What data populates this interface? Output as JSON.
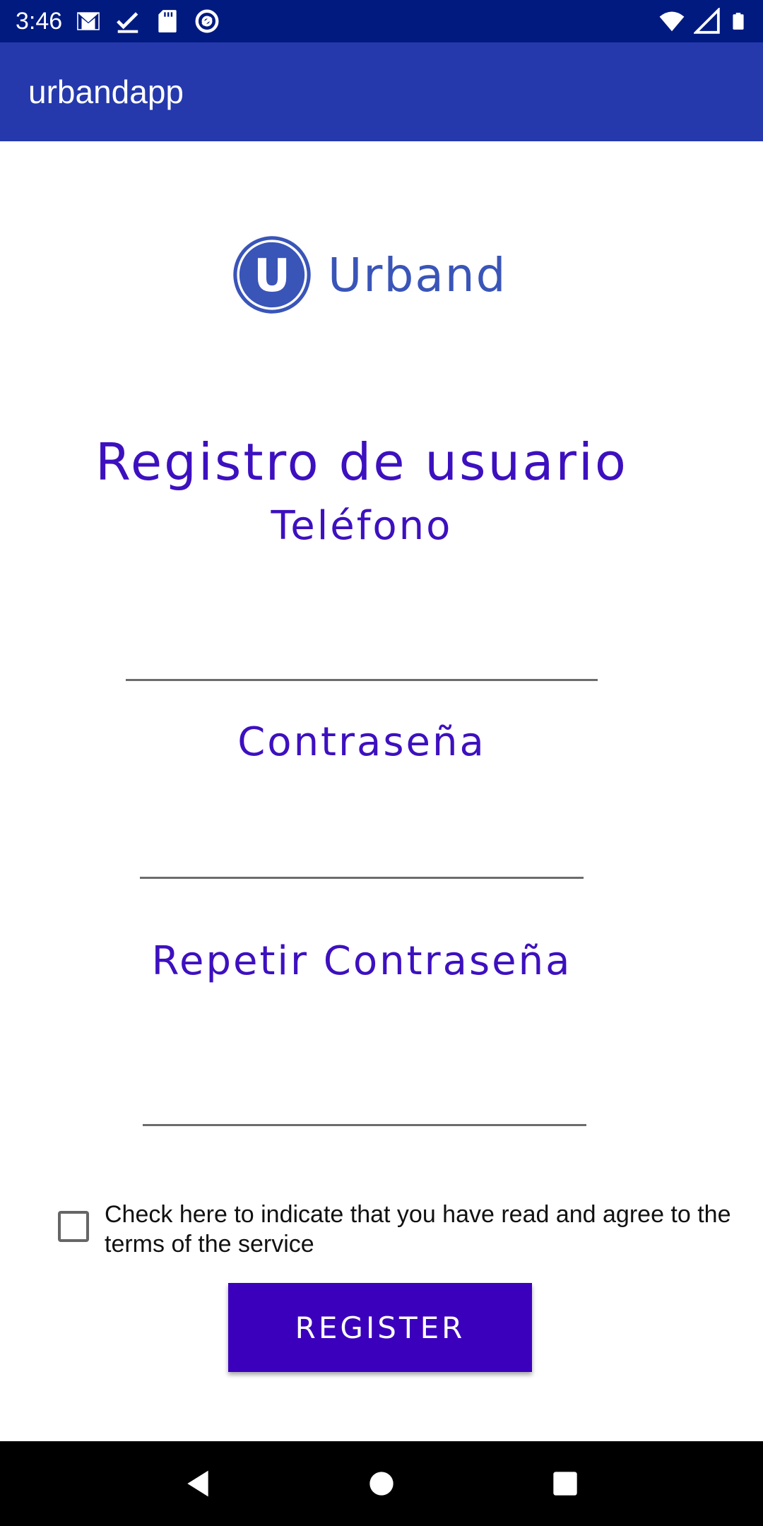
{
  "status_bar": {
    "time": "3:46",
    "left_icons": [
      "gmail-icon",
      "task-check-icon",
      "sd-card-icon",
      "vpn-at-icon"
    ],
    "right_icons": [
      "wifi-icon",
      "cell-signal-icon",
      "battery-icon"
    ]
  },
  "app_bar": {
    "title": "urbandapp"
  },
  "logo": {
    "letter": "U",
    "text": "Urband",
    "color": "#3a55b8"
  },
  "form": {
    "title": "Registro de usuario",
    "phone_label": "Teléfono",
    "phone_value": "",
    "password_label": "Contraseña",
    "password_value": "",
    "repeat_password_label": "Repetir Contraseña",
    "repeat_password_value": "",
    "terms_text": "Check here to indicate that you have read and agree to the terms of the service",
    "terms_checked": false,
    "register_label": "REGISTER"
  },
  "colors": {
    "status_bar": "#001a80",
    "app_bar": "#2539ad",
    "heading": "#3d10bf",
    "button": "#3b00bc"
  },
  "nav_bar": {
    "buttons": [
      "back-icon",
      "home-icon",
      "recents-icon"
    ]
  }
}
